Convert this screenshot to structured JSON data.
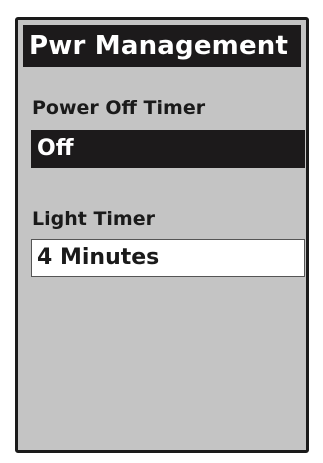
{
  "screen": {
    "title": "Pwr Management",
    "fields": [
      {
        "label": "Power Off Timer",
        "value": "Off",
        "selected": true
      },
      {
        "label": "Light Timer",
        "value": "4 Minutes",
        "selected": false
      }
    ]
  },
  "colors": {
    "screen_background": "#c4c4c4",
    "highlight": "#1c1a1b",
    "text": "#1a1a1a",
    "field_background": "#ffffff"
  }
}
